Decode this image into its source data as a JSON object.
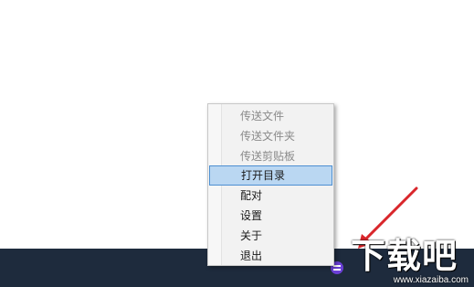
{
  "context_menu": {
    "items": [
      {
        "label": "传送文件",
        "state": "disabled"
      },
      {
        "label": "传送文件夹",
        "state": "disabled"
      },
      {
        "label": "传送剪贴板",
        "state": "disabled"
      },
      {
        "label": "打开目录",
        "state": "highlighted"
      },
      {
        "label": "配对",
        "state": "normal"
      },
      {
        "label": "设置",
        "state": "normal"
      },
      {
        "label": "关于",
        "state": "normal"
      },
      {
        "label": "退出",
        "state": "normal"
      }
    ]
  },
  "taskbar": {
    "background": "#1e2b3d",
    "tray_overflow_glyph": "^",
    "tray_icons": [
      "chevron-up-icon",
      "app-tray-icon"
    ]
  },
  "watermark": {
    "logo_text": "下载吧",
    "domain": "www.xiazaiba.com"
  },
  "colors": {
    "menu_background": "#f2f2f2",
    "highlight_fill": "#bad7f2",
    "highlight_border": "#4d8fd1",
    "annotation_arrow": "#d9262b",
    "tray_app_icon": "#6a3fd6"
  }
}
